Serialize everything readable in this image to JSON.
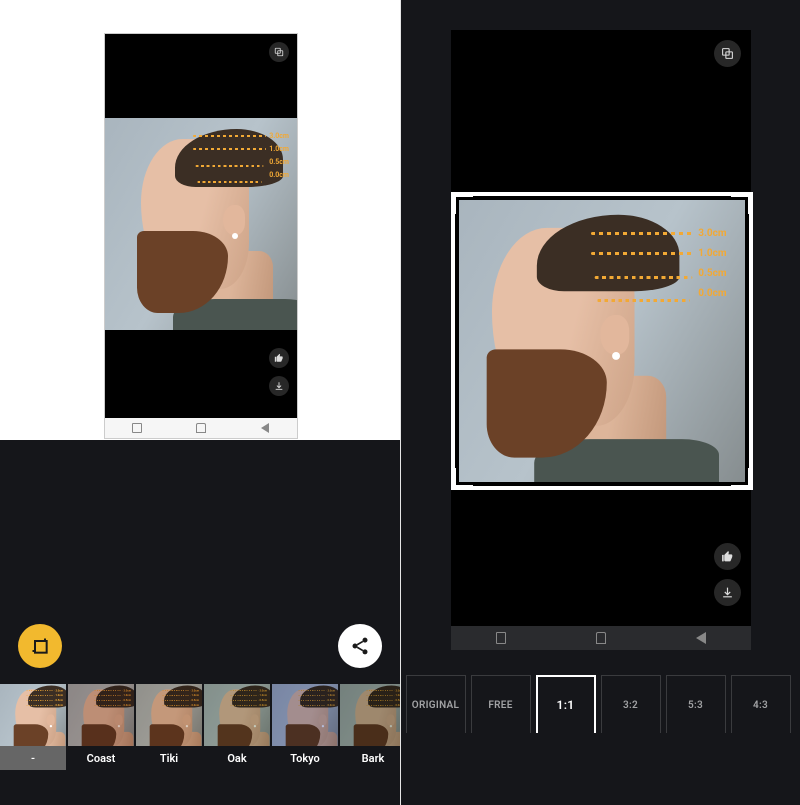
{
  "hair_guides": [
    "3.0cm",
    "1.0cm",
    "0.5cm",
    "0.0cm"
  ],
  "filters": [
    {
      "name": "-",
      "tint": ""
    },
    {
      "name": "Coast",
      "tint": "t-coast"
    },
    {
      "name": "Tiki",
      "tint": "t-tiki"
    },
    {
      "name": "Oak",
      "tint": "t-oak"
    },
    {
      "name": "Tokyo",
      "tint": "t-tokyo"
    },
    {
      "name": "Bark",
      "tint": "t-bark"
    }
  ],
  "filters_selected": 0,
  "aspect_ratios": [
    "ORIGINAL",
    "FREE",
    "1:1",
    "3:2",
    "5:3",
    "4:3"
  ],
  "aspect_selected": 2,
  "icons": {
    "compare": "compare-icon",
    "like": "thumbs-up-icon",
    "download": "download-icon",
    "crop": "crop-icon",
    "share": "share-icon"
  }
}
